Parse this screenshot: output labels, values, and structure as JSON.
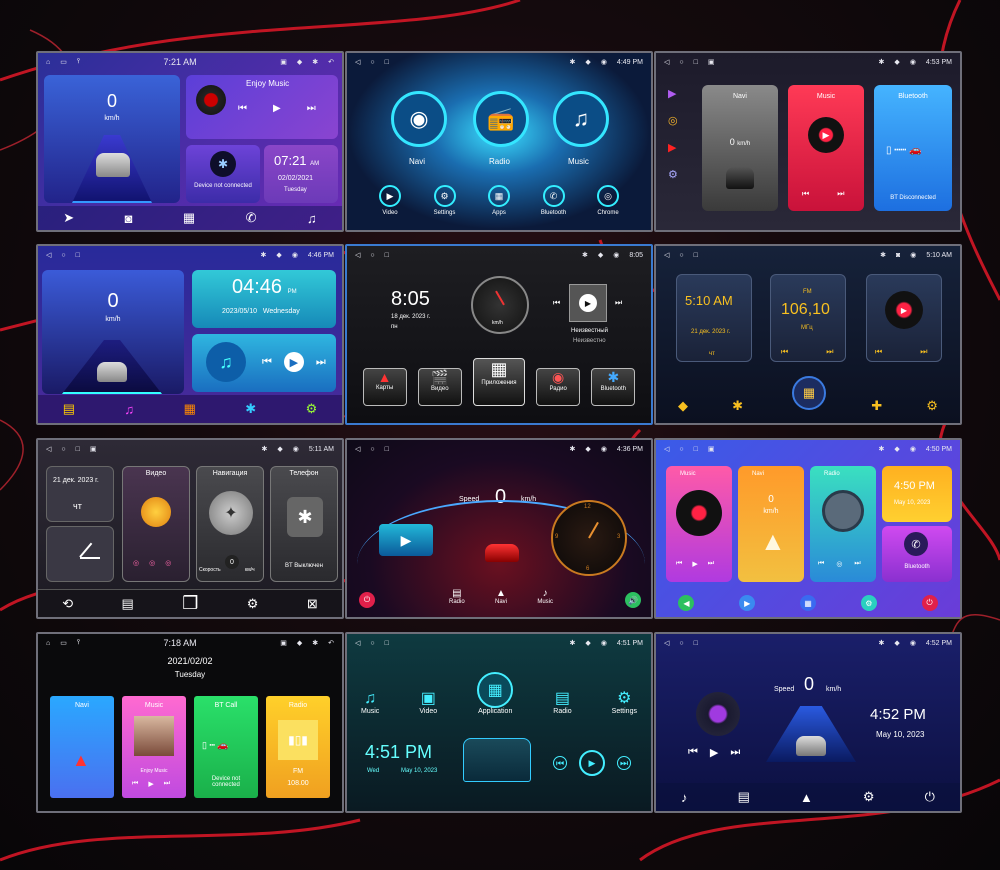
{
  "colors": {
    "accent_red": "#e02030",
    "bg": "#100a0d"
  },
  "status": {
    "home": "⌂",
    "back": "◁",
    "circle": "○",
    "square": "□",
    "bt": "✱",
    "wifi": "◉",
    "loc": "◆",
    "ret": "↶",
    "usb": "⫯"
  },
  "s1": {
    "time": "7:21 AM",
    "speed": "0",
    "unit": "km/h",
    "music_title": "Enjoy Music",
    "bt_text": "Device not connected",
    "clock": "07:21",
    "ampm": "AM",
    "date": "02/02/2021",
    "day": "Tuesday"
  },
  "s2": {
    "time": "4:49 PM",
    "navi": "Navi",
    "radio": "Radio",
    "music": "Music",
    "apps": [
      "Video",
      "Settings",
      "Apps",
      "Bluetooth",
      "Chrome"
    ]
  },
  "s3": {
    "time": "4:53 PM",
    "navi": "Navi",
    "music": "Music",
    "bluetooth": "Bluetooth",
    "speed": "0",
    "unit": "km/h",
    "bt_status": "BT Disconnected"
  },
  "s4": {
    "time": "4:46 PM",
    "speed": "0",
    "unit": "km/h",
    "clock": "04:46",
    "ampm": "PM",
    "date": "2023/05/10",
    "day": "Wednesday"
  },
  "s5": {
    "time": "8:05",
    "clock": "8:05",
    "date": "18 дек. 2023 г.",
    "day": "пн",
    "unit": "km/h",
    "artist": "Неизвестный",
    "album": "Неизвестно",
    "apps": [
      "Карты",
      "Видео",
      "Приложения",
      "Радио",
      "Bluetooth"
    ]
  },
  "s6": {
    "time": "5:10 AM",
    "clock": "5:10 AM",
    "date": "21 дек. 2023 г.",
    "day": "чт",
    "freq": "106,10",
    "band": "FM",
    "mhz": "МГц"
  },
  "s7": {
    "time": "5:11 AM",
    "date": "21 дек. 2023 г.",
    "day": "чт",
    "video": "Видео",
    "navi": "Навигация",
    "phone": "Телефон",
    "speed_label": "Скорость",
    "speed": "0",
    "unit": "км/ч",
    "bt": "BT Выключен"
  },
  "s8": {
    "time": "4:36 PM",
    "speed_label": "Speed",
    "speed": "0",
    "unit": "km/h",
    "clock_nums": [
      "12",
      "3",
      "6",
      "9"
    ],
    "apps": [
      "Radio",
      "Navi",
      "Music"
    ]
  },
  "s9": {
    "time": "4:50 PM",
    "music": "Music",
    "navi": "Navi",
    "radio": "Radio",
    "speed": "0",
    "unit": "km/h",
    "clock": "4:50 PM",
    "date": "May 10, 2023",
    "bluetooth": "Bluetooth"
  },
  "s10": {
    "time": "7:18 AM",
    "date": "2021/02/02",
    "day": "Tuesday",
    "navi": "Navi",
    "music": "Music",
    "enjoy": "Enjoy Music",
    "btcall": "BT Call",
    "bt_status": "Device not connected",
    "radio": "Radio",
    "band": "FM",
    "freq": "108.00"
  },
  "s11": {
    "time": "4:51 PM",
    "apps": [
      "Music",
      "Video",
      "Application",
      "Radio",
      "Settings"
    ],
    "clock": "4:51 PM",
    "day": "Wed",
    "date": "May 10, 2023"
  },
  "s12": {
    "time": "4:52 PM",
    "speed_label": "Speed",
    "speed": "0",
    "unit": "km/h",
    "clock": "4:52 PM",
    "date": "May 10, 2023"
  }
}
